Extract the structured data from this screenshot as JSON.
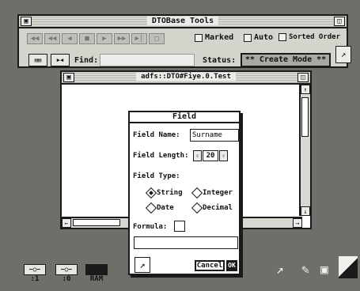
{
  "tools_window": {
    "title": "DTOBase Tools",
    "close_glyph": "▣",
    "toggle_glyph": "◫",
    "nav_buttons": [
      "◀◀",
      "◀◀",
      "◀",
      "■",
      "▶",
      "▶▶",
      "▶|",
      "□"
    ],
    "marked_label": "Marked",
    "auto_label": "Auto",
    "sorted_label": "Sorted Order",
    "find_label": "Find:",
    "find_value": "",
    "status_label": "Status:",
    "status_value": "** Create Mode **"
  },
  "data_window": {
    "title": "adfs::DTO#Fiye.0.Test",
    "close_glyph": "▣",
    "full_glyph": "◫",
    "up_arrow": "↑",
    "down_arrow": "↓",
    "left_arrow": "←",
    "right_arrow": "→"
  },
  "field_dialog": {
    "title": "Field",
    "name_label": "Field Name:",
    "name_value": "Surname",
    "length_label": "Field Length:",
    "length_value": "20",
    "length_down": "⇩",
    "length_up": "⇧",
    "type_label": "Field Type:",
    "types": [
      {
        "label": "String",
        "selected": true
      },
      {
        "label": "Integer",
        "selected": false
      },
      {
        "label": "Date",
        "selected": false
      },
      {
        "label": "Decimal",
        "selected": false
      }
    ],
    "formula_label": "Formula:",
    "formula_value": "",
    "cancel_label": "Cancel",
    "ok_label": "OK"
  },
  "desktop": {
    "dock": [
      {
        "icon": "−○−",
        "label": ":1"
      },
      {
        "icon": "−○−",
        "label": ":0"
      },
      {
        "icon": "",
        "label": "RAM"
      }
    ]
  }
}
